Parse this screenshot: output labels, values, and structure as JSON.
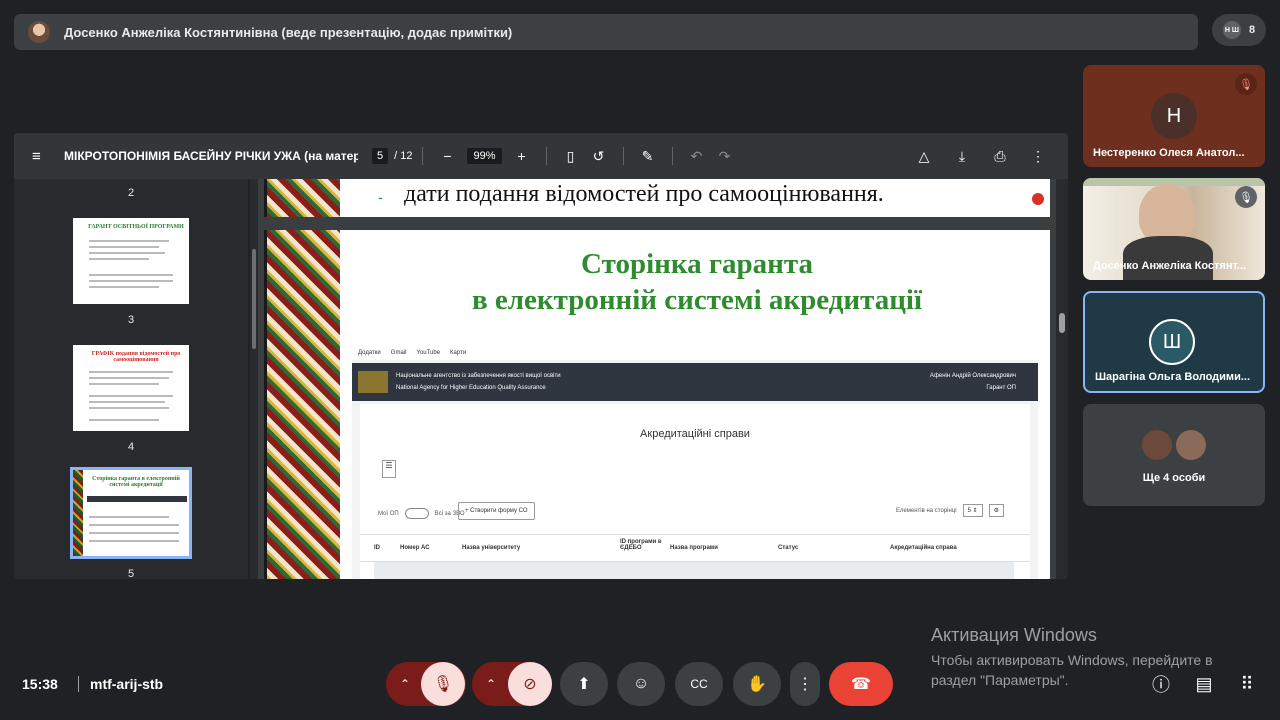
{
  "presenter": {
    "text": "Досенко Анжеліка Костянтинівна (веде презентацію, додає примітки)"
  },
  "participants_count": "8",
  "viewer": {
    "title": "МІКРОТОПОНІМІЯ БАСЕЙНУ РІЧКИ УЖА (на матері...",
    "page": "5",
    "page_total": "/ 12",
    "zoom": "99%"
  },
  "thumbnails": [
    {
      "num": "2"
    },
    {
      "num": "3",
      "title": "ГАРАНТ ОСВІТНЬОЇ ПРОГРАМИ"
    },
    {
      "num": "4",
      "title": "ГРАФІК подання відомостей про самооцінювання"
    },
    {
      "num": "5",
      "title": "Сторінка гаранта в електронній системі акредитації"
    }
  ],
  "slide": {
    "top_line": "дати подання відомостей про самооцінювання.",
    "top_dash": "-",
    "heading_line1": "Сторінка гаранта",
    "heading_line2": "в електронній системі акредитації",
    "bookmarks": [
      "Додатки",
      "Gmail",
      "YouTube",
      "Карти"
    ],
    "agency_ua": "Національне агентство із забезпечення якості вищої освіти",
    "agency_en": "National Agency for Higher Education Quality Assurance",
    "user": "Афенін Андрій Олександрович",
    "role": "Гарант ОП",
    "acc_title": "Акредитаційні справи",
    "toggle_left": "Мої ОП",
    "toggle_right": "Всі за ЗВО",
    "create_btn": "+ Створити форму СО",
    "per_page_label": "Елементів на сторінці",
    "per_page_value": "5 ⇕",
    "columns": [
      "ID",
      "Номер АС",
      "Назва університету",
      "ID програми в ЄДЕБО",
      "Назва програми",
      "Статус",
      "Акредитаційна справа"
    ]
  },
  "tiles": [
    {
      "initial": "Н",
      "name": "Нестеренко Олеся Анатол..."
    },
    {
      "name": "Досенко Анжеліка Костянт..."
    },
    {
      "initial": "Ш",
      "name": "Шарагіна Ольга Володими..."
    },
    {
      "name": "Ще 4 особи"
    }
  ],
  "bottom": {
    "time": "15:38",
    "meeting_code": "mtf-arij-stb"
  },
  "windows": {
    "title": "Активация Windows",
    "sub": "Чтобы активировать Windows, перейдите в раздел \"Параметры\"."
  },
  "colors": {
    "accent": "#8ab4f8",
    "danger": "#ea4335",
    "muted_bg": "#7a1d1a"
  }
}
